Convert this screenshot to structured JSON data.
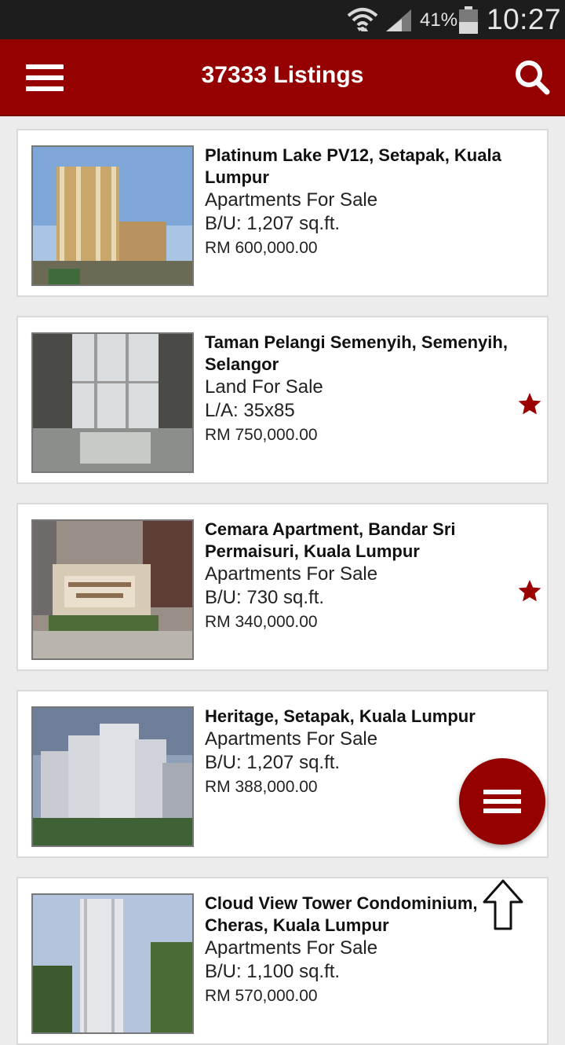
{
  "status_bar": {
    "battery": "41%",
    "time": "10:27"
  },
  "app_bar": {
    "title": "37333 Listings",
    "menu_icon": "hamburger-menu-icon",
    "search_icon": "search-icon"
  },
  "listings": [
    {
      "name": "Platinum Lake PV12, Setapak, Kuala Lumpur",
      "type": "Apartments For Sale",
      "size": "B/U: 1,207 sq.ft.",
      "price": "RM 600,000.00",
      "favorited": false
    },
    {
      "name": "Taman Pelangi Semenyih, Semenyih, Selangor",
      "type": "Land For Sale",
      "size": "L/A: 35x85",
      "price": "RM 750,000.00",
      "favorited": true
    },
    {
      "name": "Cemara Apartment, Bandar Sri Permaisuri, Kuala Lumpur",
      "type": "Apartments For Sale",
      "size": "B/U: 730 sq.ft.",
      "price": "RM 340,000.00",
      "favorited": true
    },
    {
      "name": "Heritage, Setapak, Kuala Lumpur",
      "type": "Apartments For Sale",
      "size": "B/U: 1,207 sq.ft.",
      "price": "RM 388,000.00",
      "favorited": false
    },
    {
      "name": "Cloud View Tower Condominium, Cheras, Kuala Lumpur",
      "type": "Apartments For Sale",
      "size": "B/U: 1,100 sq.ft.",
      "price": "RM 570,000.00",
      "favorited": false
    }
  ],
  "colors": {
    "brand": "#950000",
    "star": "#9b0000"
  },
  "fab": {
    "icon": "menu-icon"
  },
  "scroll_top": {
    "icon": "arrow-up-icon"
  }
}
